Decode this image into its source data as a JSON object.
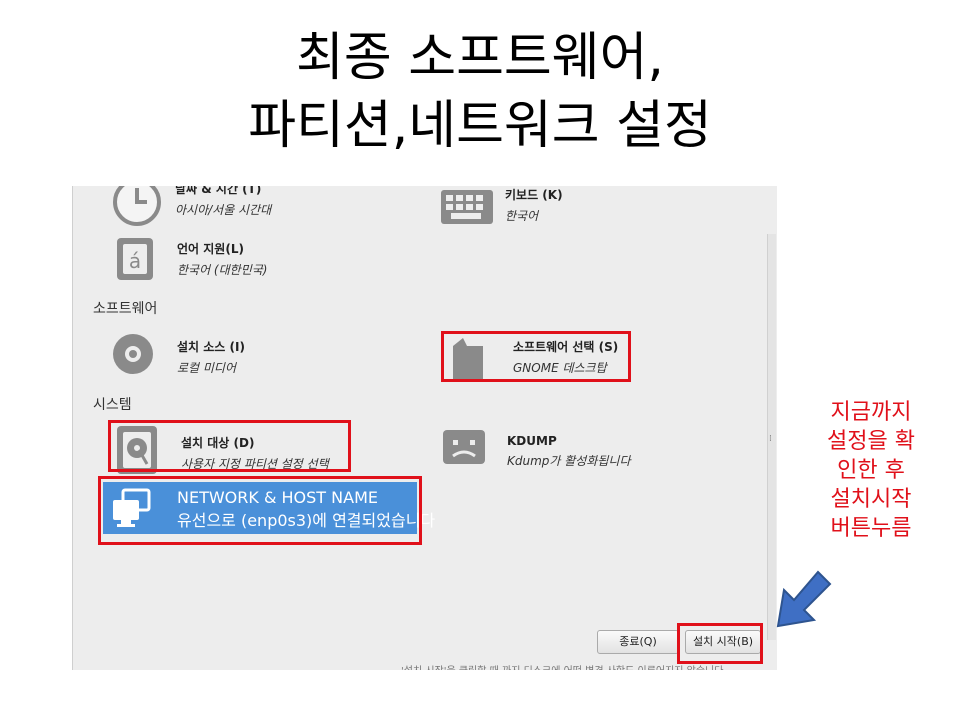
{
  "slide": {
    "title_line1": "최종 소프트웨어,",
    "title_line2": "파티션,네트워크 설정",
    "annotation": [
      "지금까지",
      "설정을 확",
      "인한 후",
      "설치시작",
      "버튼누름"
    ]
  },
  "installer": {
    "sections": {
      "software": "소프트웨어",
      "system": "시스템"
    },
    "spokes": {
      "datetime": {
        "title": "날짜 & 시간 (T)",
        "status": "아시아/서울 시간대",
        "icon": "clock-icon"
      },
      "keyboard": {
        "title": "키보드 (K)",
        "status": "한국어",
        "icon": "keyboard-icon"
      },
      "language": {
        "title": "언어 지원(L)",
        "status": "한국어 (대한민국)",
        "icon": "language-icon"
      },
      "source": {
        "title": "설치 소스 (I)",
        "status": "로컬 미디어",
        "icon": "disc-icon"
      },
      "software_selection": {
        "title": "소프트웨어 선택 (S)",
        "status": "GNOME 데스크탑",
        "icon": "package-icon"
      },
      "destination": {
        "title": "설치 대상 (D)",
        "status": "사용자 지정 파티션 설정 선택",
        "icon": "harddisk-icon"
      },
      "kdump": {
        "title": "KDUMP",
        "status": "Kdump가 활성화됩니다",
        "icon": "kdump-icon"
      },
      "network": {
        "title": "NETWORK & HOST NAME",
        "status": "유선으로 (enp0s3)에 연결되었습니다",
        "icon": "network-icon"
      }
    },
    "buttons": {
      "quit": "종료(Q)",
      "begin": "설치 시작(B)"
    },
    "footnote": "'설치 시작'을 클릭할 때 까지 디스크에 어떤 변경 사항도 이루어지지 않습니다",
    "colors": {
      "selected_spoke": "#4a90d9",
      "highlight_box": "#e0101a",
      "annotation_text": "#e0101a",
      "arrow": "#3f6fc4"
    }
  }
}
